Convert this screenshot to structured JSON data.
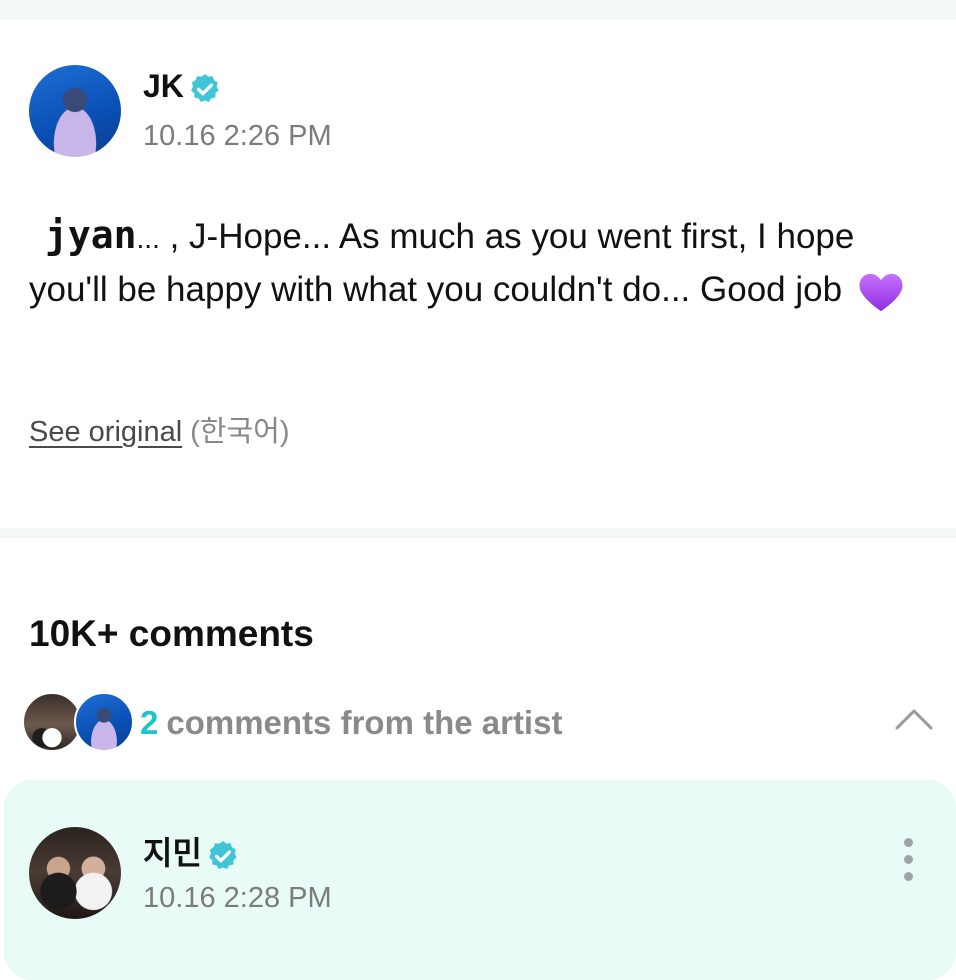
{
  "post": {
    "author": "JK",
    "timestamp": "10.16 2:26 PM",
    "text_mono": "jyan",
    "text_dots": "...",
    "text_main": ", J-Hope... As much as you went first, I hope you'll be happy with what you couldn't do... Good job",
    "heart_emoji": "purple-heart",
    "see_original": "See original",
    "original_language": "(한국어)"
  },
  "comments": {
    "title": "10K+ comments",
    "artist_count": "2",
    "artist_label": "comments from the artist"
  },
  "comment": {
    "author": "지민",
    "timestamp": "10.16 2:28 PM"
  },
  "colors": {
    "accent": "#1fc4c9",
    "verified": "#3fc5d6",
    "card_bg": "#e8fbf7"
  }
}
